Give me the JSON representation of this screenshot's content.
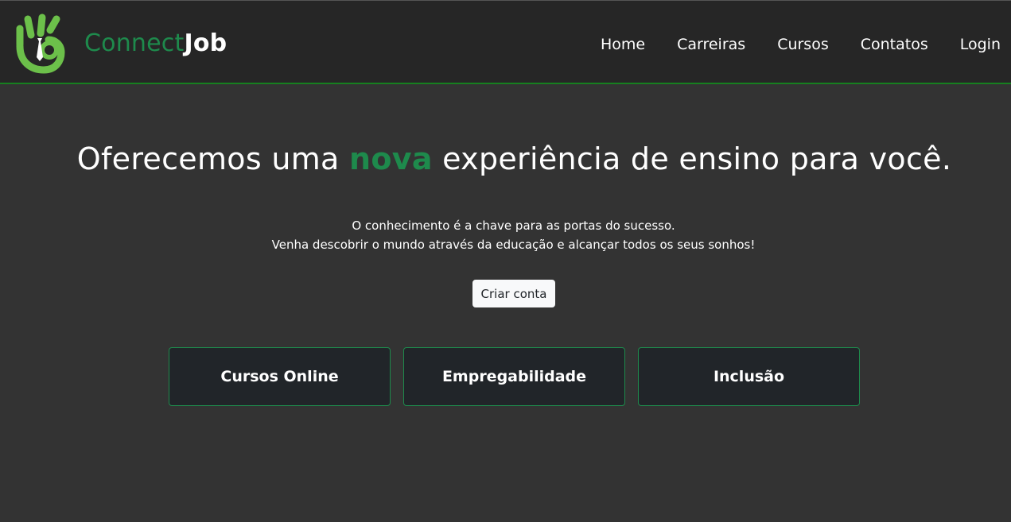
{
  "brand": {
    "part1": "Connect",
    "part2": "Job",
    "logo_icon": "ok-hand-tie-icon"
  },
  "nav": {
    "items": [
      "Home",
      "Carreiras",
      "Cursos",
      "Contatos",
      "Login"
    ]
  },
  "hero": {
    "title_before": "Oferecemos uma ",
    "title_highlight": "nova",
    "title_after": " experiência de ensino para você.",
    "subtitle_line1": "O conhecimento é a chave para as portas do sucesso.",
    "subtitle_line2": "Venha descobrir o mundo através da educação e alcançar todos os seus sonhos!",
    "cta_label": "Criar conta"
  },
  "cards": [
    "Cursos Online",
    "Empregabilidade",
    "Inclusão"
  ],
  "colors": {
    "accent": "#1e8a4c",
    "logo_green": "#6cc04a",
    "navbar_bg": "#262626",
    "page_bg": "#333333",
    "card_bg": "#212529"
  }
}
